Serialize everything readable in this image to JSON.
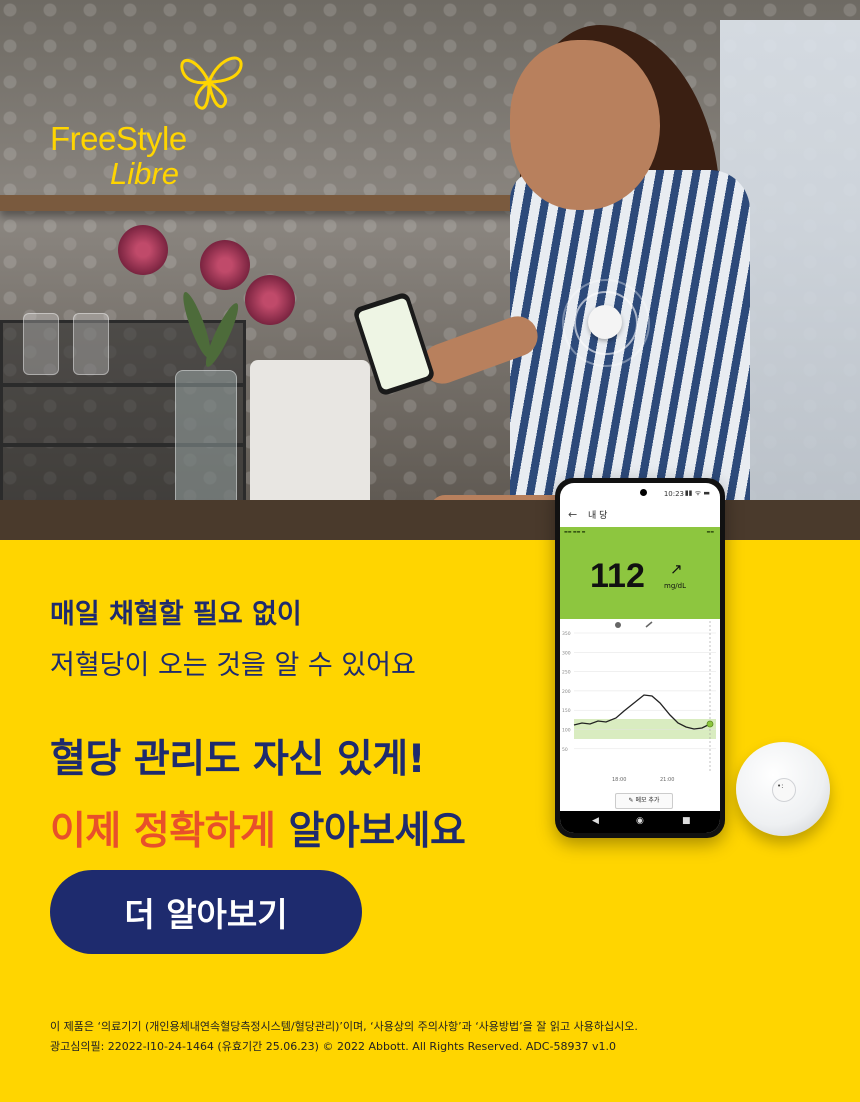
{
  "brand": {
    "line1": "FreeStyle",
    "line2": "Libre",
    "color": "#FFD500",
    "icon": "butterfly-icon"
  },
  "copy": {
    "headline1": "매일 채혈할 필요 없이",
    "headline2": "저혈당이 오는 것을 알 수 있어요",
    "big1": "혈당 관리도 자신 있게!",
    "big2_red": "이제 정확하게",
    "big2_blue": "알아보세요",
    "cta": "더 알아보기"
  },
  "colors": {
    "background": "#FFD500",
    "navy": "#1e2b6e",
    "accent_red": "#e8502a",
    "app_green": "#8dc63f"
  },
  "phone": {
    "time": "10:23",
    "status_icons": "▮▮ ᯤ ▬",
    "title": "내 당",
    "reading": "112",
    "unit": "mg/dL",
    "trend_icon": "↗",
    "memo_button": "메모 추가",
    "chart_y_ticks": [
      "350",
      "300",
      "250",
      "200",
      "150",
      "100",
      "50"
    ],
    "chart_x_ticks": [
      "18:00",
      "21:00"
    ]
  },
  "fine_print": {
    "line1": "이 제품은 ‘의료기기 (개인용체내연속혈당측정시스템/혈당관리)’이며, ‘사용상의 주의사항’과 ‘사용방법’을 잘 읽고 사용하십시오.",
    "line2": "광고심의필: 22022-I10-24-1464 (유효기간 25.06.23) © 2022 Abbott. All Rights Reserved. ADC-58937 v1.0"
  }
}
